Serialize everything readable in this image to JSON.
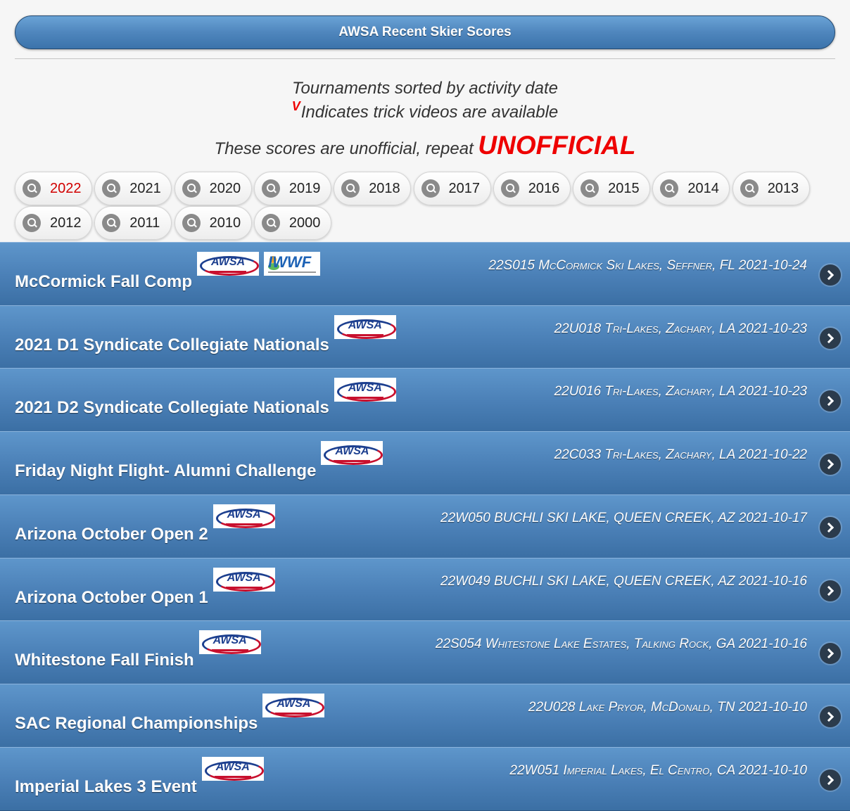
{
  "header": {
    "title": "AWSA Recent Skier Scores"
  },
  "intro": {
    "line1": "Tournaments sorted by activity date",
    "video_mark": "V",
    "line2": "Indicates trick videos are available",
    "line3_prefix": "These scores are unofficial, repeat ",
    "line3_emphasis": "UNOFFICIAL"
  },
  "years": [
    {
      "label": "2022",
      "active": true
    },
    {
      "label": "2021"
    },
    {
      "label": "2020"
    },
    {
      "label": "2019"
    },
    {
      "label": "2018"
    },
    {
      "label": "2017"
    },
    {
      "label": "2016"
    },
    {
      "label": "2015"
    },
    {
      "label": "2014"
    },
    {
      "label": "2013"
    },
    {
      "label": "2012"
    },
    {
      "label": "2011"
    },
    {
      "label": "2010"
    },
    {
      "label": "2000"
    }
  ],
  "tournaments": [
    {
      "title": "McCormick Fall Comp",
      "meta": "22S015 McCormick Ski Lakes, Seffner, FL 2021-10-24",
      "badges": [
        "AWSA",
        "IWWF"
      ]
    },
    {
      "title": "2021 D1 Syndicate Collegiate Nationals",
      "meta": "22U018 Tri-Lakes, Zachary, LA 2021-10-23",
      "badges": [
        "AWSA"
      ]
    },
    {
      "title": "2021 D2 Syndicate Collegiate Nationals",
      "meta": "22U016 Tri-Lakes, Zachary, LA 2021-10-23",
      "badges": [
        "AWSA"
      ]
    },
    {
      "title": "Friday Night Flight- Alumni Challenge",
      "meta": "22C033 Tri-Lakes, Zachary, LA 2021-10-22",
      "badges": [
        "AWSA"
      ]
    },
    {
      "title": "Arizona October Open 2",
      "meta": "22W050 BUCHLI SKI LAKE, QUEEN CREEK, AZ 2021-10-17",
      "badges": [
        "AWSA"
      ],
      "caps": true
    },
    {
      "title": "Arizona October Open 1",
      "meta": "22W049 BUCHLI SKI LAKE, QUEEN CREEK, AZ 2021-10-16",
      "badges": [
        "AWSA"
      ],
      "caps": true
    },
    {
      "title": "Whitestone Fall Finish",
      "meta": "22S054 Whitestone Lake Estates, Talking Rock, GA 2021-10-16",
      "badges": [
        "AWSA"
      ]
    },
    {
      "title": "SAC Regional Championships",
      "meta": "22U028 Lake Pryor, McDonald, TN 2021-10-10",
      "badges": [
        "AWSA"
      ]
    },
    {
      "title": "Imperial Lakes 3 Event",
      "meta": "22W051 Imperial Lakes, El Centro, CA 2021-10-10",
      "badges": [
        "AWSA"
      ]
    }
  ]
}
